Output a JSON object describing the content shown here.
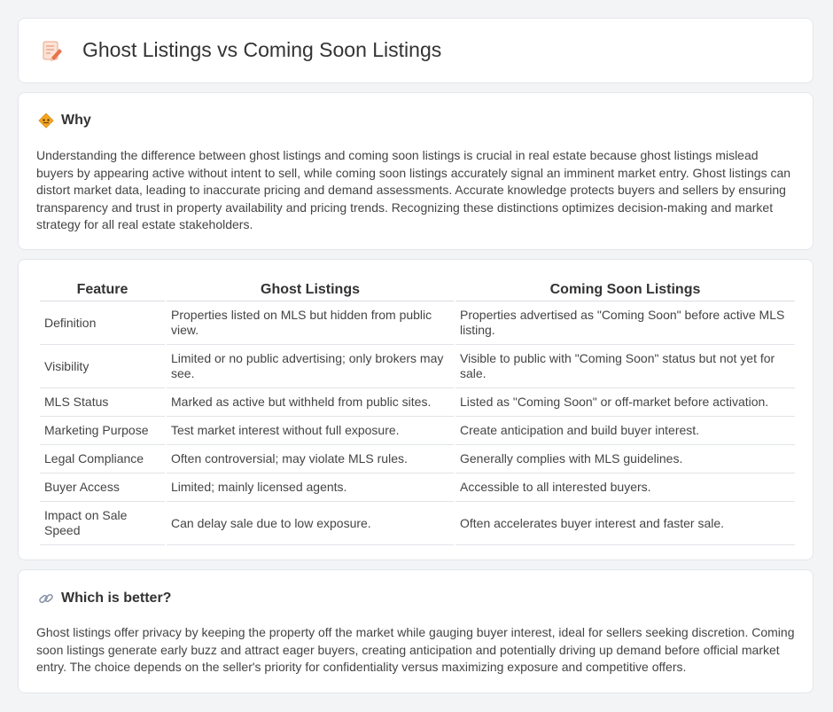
{
  "header": {
    "title": "Ghost Listings vs Coming Soon Listings",
    "icon": "pencil-document-icon"
  },
  "why": {
    "heading": "Why",
    "icon": "warning-sign-icon",
    "text": "Understanding the difference between ghost listings and coming soon listings is crucial in real estate because ghost listings mislead buyers by appearing active without intent to sell, while coming soon listings accurately signal an imminent market entry. Ghost listings can distort market data, leading to inaccurate pricing and demand assessments. Accurate knowledge protects buyers and sellers by ensuring transparency and trust in property availability and pricing trends. Recognizing these distinctions optimizes decision-making and market strategy for all real estate stakeholders."
  },
  "table": {
    "headers": [
      "Feature",
      "Ghost Listings",
      "Coming Soon Listings"
    ],
    "rows": [
      [
        "Definition",
        "Properties listed on MLS but hidden from public view.",
        "Properties advertised as \"Coming Soon\" before active MLS listing."
      ],
      [
        "Visibility",
        "Limited or no public advertising; only brokers may see.",
        "Visible to public with \"Coming Soon\" status but not yet for sale."
      ],
      [
        "MLS Status",
        "Marked as active but withheld from public sites.",
        "Listed as \"Coming Soon\" or off-market before activation."
      ],
      [
        "Marketing Purpose",
        "Test market interest without full exposure.",
        "Create anticipation and build buyer interest."
      ],
      [
        "Legal Compliance",
        "Often controversial; may violate MLS rules.",
        "Generally complies with MLS guidelines."
      ],
      [
        "Buyer Access",
        "Limited; mainly licensed agents.",
        "Accessible to all interested buyers."
      ],
      [
        "Impact on Sale Speed",
        "Can delay sale due to low exposure.",
        "Often accelerates buyer interest and faster sale."
      ]
    ]
  },
  "better": {
    "heading": "Which is better?",
    "icon": "link-icon",
    "text": "Ghost listings offer privacy by keeping the property off the market while gauging buyer interest, ideal for sellers seeking discretion. Coming soon listings generate early buzz and attract eager buyers, creating anticipation and potentially driving up demand before official market entry. The choice depends on the seller's priority for confidentiality versus maximizing exposure and competitive offers."
  },
  "colors": {
    "accent": "#e8734a",
    "warning": "#f0a020",
    "link": "#8a96a8"
  }
}
